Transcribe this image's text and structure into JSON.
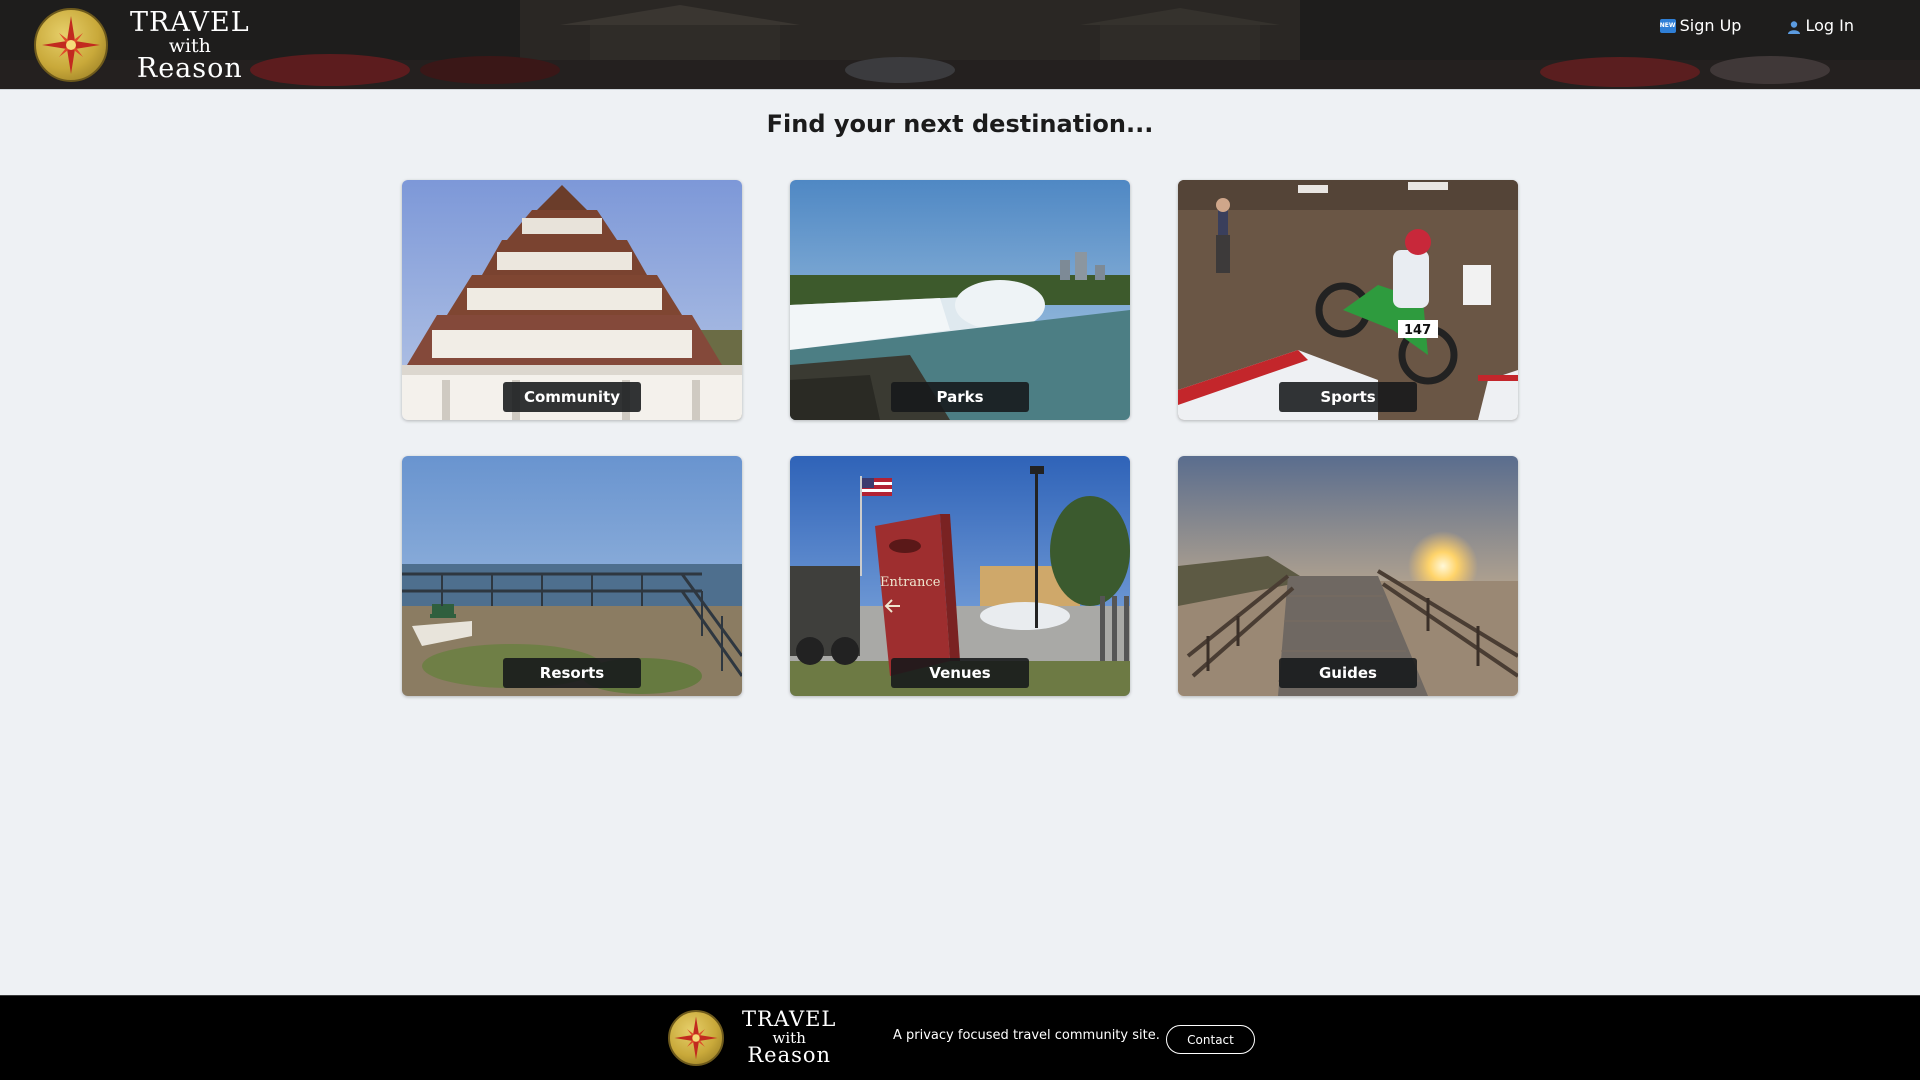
{
  "header": {
    "brand": {
      "line1": "TRAVEL",
      "line2": "with",
      "line3": "Reason"
    },
    "nav": {
      "signup_badge": "NEW",
      "signup_label": "Sign Up",
      "login_label": "Log In"
    }
  },
  "main": {
    "heading": "Find your next destination...",
    "cards": [
      {
        "label": "Community"
      },
      {
        "label": "Parks"
      },
      {
        "label": "Sports"
      },
      {
        "label": "Resorts"
      },
      {
        "label": "Venues"
      },
      {
        "label": "Guides"
      }
    ]
  },
  "footer": {
    "brand": {
      "line1": "TRAVEL",
      "line2": "with",
      "line3": "Reason"
    },
    "tagline": "A privacy focused travel community site.",
    "contact_label": "Contact"
  },
  "photo_text": {
    "venues_sign": "Entrance",
    "sports_number": "147"
  }
}
